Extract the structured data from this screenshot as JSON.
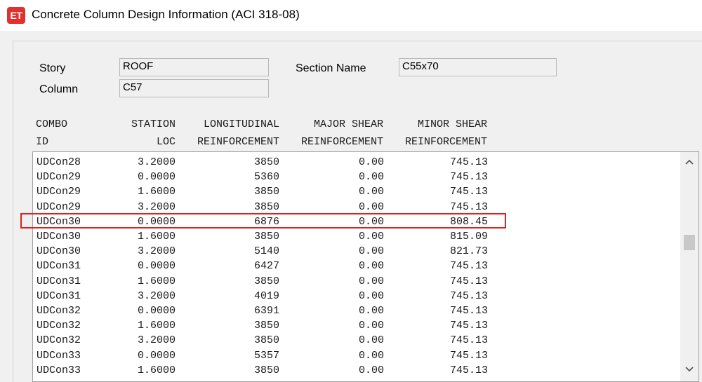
{
  "window": {
    "icon_text": "ET",
    "title": "Concrete Column Design Information (ACI 318-08)"
  },
  "info": {
    "story_label": "Story",
    "story_value": "ROOF",
    "column_label": "Column",
    "column_value": "C57",
    "section_label": "Section Name",
    "section_value": "C55x70"
  },
  "table": {
    "headers": {
      "combo_line1": "COMBO",
      "combo_line2": "ID",
      "station_line1": "STATION",
      "station_line2": "LOC",
      "long_line1": "LONGITUDINAL",
      "long_line2": "REINFORCEMENT",
      "major_line1": "MAJOR SHEAR",
      "major_line2": "REINFORCEMENT",
      "minor_line1": "MINOR SHEAR",
      "minor_line2": "REINFORCEMENT"
    },
    "rows": [
      {
        "combo": "UDCon28",
        "station": "3.2000",
        "long": "3850",
        "major": "0.00",
        "minor": "745.13"
      },
      {
        "combo": "UDCon29",
        "station": "0.0000",
        "long": "5360",
        "major": "0.00",
        "minor": "745.13"
      },
      {
        "combo": "UDCon29",
        "station": "1.6000",
        "long": "3850",
        "major": "0.00",
        "minor": "745.13"
      },
      {
        "combo": "UDCon29",
        "station": "3.2000",
        "long": "3850",
        "major": "0.00",
        "minor": "745.13"
      },
      {
        "combo": "UDCon30",
        "station": "0.0000",
        "long": "6876",
        "major": "0.00",
        "minor": "808.45"
      },
      {
        "combo": "UDCon30",
        "station": "1.6000",
        "long": "3850",
        "major": "0.00",
        "minor": "815.09"
      },
      {
        "combo": "UDCon30",
        "station": "3.2000",
        "long": "5140",
        "major": "0.00",
        "minor": "821.73"
      },
      {
        "combo": "UDCon31",
        "station": "0.0000",
        "long": "6427",
        "major": "0.00",
        "minor": "745.13"
      },
      {
        "combo": "UDCon31",
        "station": "1.6000",
        "long": "3850",
        "major": "0.00",
        "minor": "745.13"
      },
      {
        "combo": "UDCon31",
        "station": "3.2000",
        "long": "4019",
        "major": "0.00",
        "minor": "745.13"
      },
      {
        "combo": "UDCon32",
        "station": "0.0000",
        "long": "6391",
        "major": "0.00",
        "minor": "745.13"
      },
      {
        "combo": "UDCon32",
        "station": "1.6000",
        "long": "3850",
        "major": "0.00",
        "minor": "745.13"
      },
      {
        "combo": "UDCon32",
        "station": "3.2000",
        "long": "3850",
        "major": "0.00",
        "minor": "745.13"
      },
      {
        "combo": "UDCon33",
        "station": "0.0000",
        "long": "5357",
        "major": "0.00",
        "minor": "745.13"
      },
      {
        "combo": "UDCon33",
        "station": "1.6000",
        "long": "3850",
        "major": "0.00",
        "minor": "745.13"
      }
    ]
  },
  "icons": {
    "scroll_up": "chevron-up-icon",
    "scroll_down": "chevron-down-icon"
  },
  "colors": {
    "highlight": "#e02020",
    "app_icon": "#e0312c"
  }
}
